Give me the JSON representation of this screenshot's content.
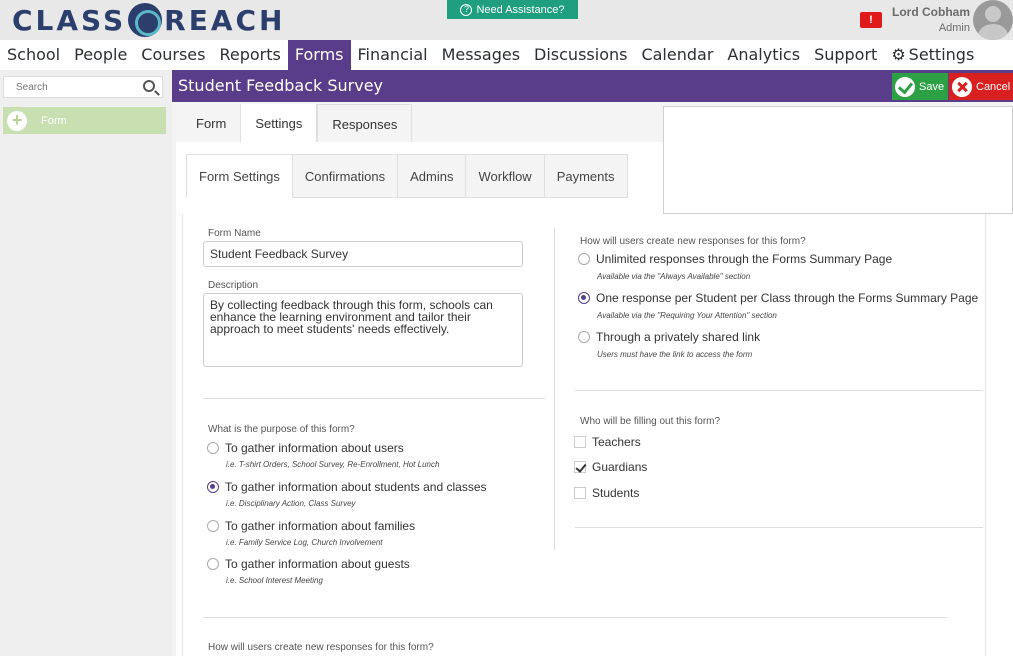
{
  "header": {
    "logo_text_1": "CLASS",
    "logo_text_2": "REACH",
    "assist_label": "Need Assistance?",
    "alert_badge": "!",
    "user_name": "Lord Cobham",
    "user_role": "Admin"
  },
  "nav": {
    "items": [
      "School",
      "People",
      "Courses",
      "Reports",
      "Forms",
      "Financial",
      "Messages",
      "Discussions",
      "Calendar",
      "Analytics",
      "Support",
      "Settings"
    ],
    "active": "Forms"
  },
  "sidebar": {
    "search_placeholder": "Search",
    "form_label": "Form"
  },
  "titlebar": {
    "title": "Student Feedback Survey",
    "save_label": "Save",
    "cancel_label": "Cancel"
  },
  "tabs_top": [
    "Form",
    "Settings",
    "Responses"
  ],
  "tabs_sub": [
    "Form Settings",
    "Confirmations",
    "Admins",
    "Workflow",
    "Payments"
  ],
  "form": {
    "name_label": "Form Name",
    "name_value": "Student Feedback Survey",
    "desc_label": "Description",
    "desc_value": "By collecting feedback through this form, schools can enhance the learning environment and tailor their approach to meet students' needs effectively.",
    "purpose_question": "What is the purpose of this form?",
    "purpose_options": [
      {
        "label": "To gather information about users",
        "hint": "i.e. T-shirt Orders, School Survey, Re-Enrollment, Hot Lunch",
        "selected": false
      },
      {
        "label": "To gather information about students and classes",
        "hint": "i.e. Disciplinary Action, Class Survey",
        "selected": true
      },
      {
        "label": "To gather information about families",
        "hint": "i.e. Family Service Log, Church Involvement",
        "selected": false
      },
      {
        "label": "To gather information about guests",
        "hint": "i.e. School Interest Meeting",
        "selected": false
      }
    ],
    "bottom_question": "How will users create new responses for this form?",
    "responses_question": "How will users create new responses for this form?",
    "responses_options": [
      {
        "label": "Unlimited responses through the Forms Summary Page",
        "hint": "Available via the \"Always Available\" section",
        "selected": false
      },
      {
        "label": "One response per Student per Class through the Forms Summary Page",
        "hint": "Available via the \"Requiring Your Attention\" section",
        "selected": true
      },
      {
        "label": "Through a privately shared link",
        "hint": "Users must have the link to access the form",
        "selected": false
      }
    ],
    "fillers_question": "Who will be filling out this form?",
    "fillers_options": [
      {
        "label": "Teachers",
        "checked": false
      },
      {
        "label": "Guardians",
        "checked": true
      },
      {
        "label": "Students",
        "checked": false
      }
    ]
  }
}
